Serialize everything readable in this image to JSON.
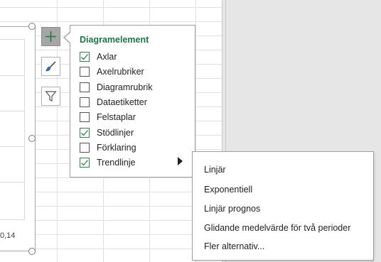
{
  "chart": {
    "axis_tick_label": "0,14"
  },
  "chart_buttons": [
    {
      "name": "chart-elements",
      "icon": "plus-icon",
      "active": true
    },
    {
      "name": "chart-styles",
      "icon": "paintbrush-icon",
      "active": false
    },
    {
      "name": "chart-filters",
      "icon": "funnel-icon",
      "active": false
    }
  ],
  "chart_elements_panel": {
    "title": "Diagramelement",
    "items": [
      {
        "label": "Axlar",
        "checked": true
      },
      {
        "label": "Axelrubriker",
        "checked": false
      },
      {
        "label": "Diagramrubrik",
        "checked": false
      },
      {
        "label": "Dataetiketter",
        "checked": false
      },
      {
        "label": "Felstaplar",
        "checked": false
      },
      {
        "label": "Stödlinjer",
        "checked": true
      },
      {
        "label": "Förklaring",
        "checked": false
      },
      {
        "label": "Trendlinje",
        "checked": true
      }
    ]
  },
  "trendline_submenu": {
    "items": [
      "Linjär",
      "Exponentiell",
      "Linjär prognos",
      "Glidande medelvärde för två perioder",
      "Fler alternativ..."
    ]
  },
  "colors": {
    "accent_green": "#217346",
    "check_green": "#3a7a4a"
  }
}
